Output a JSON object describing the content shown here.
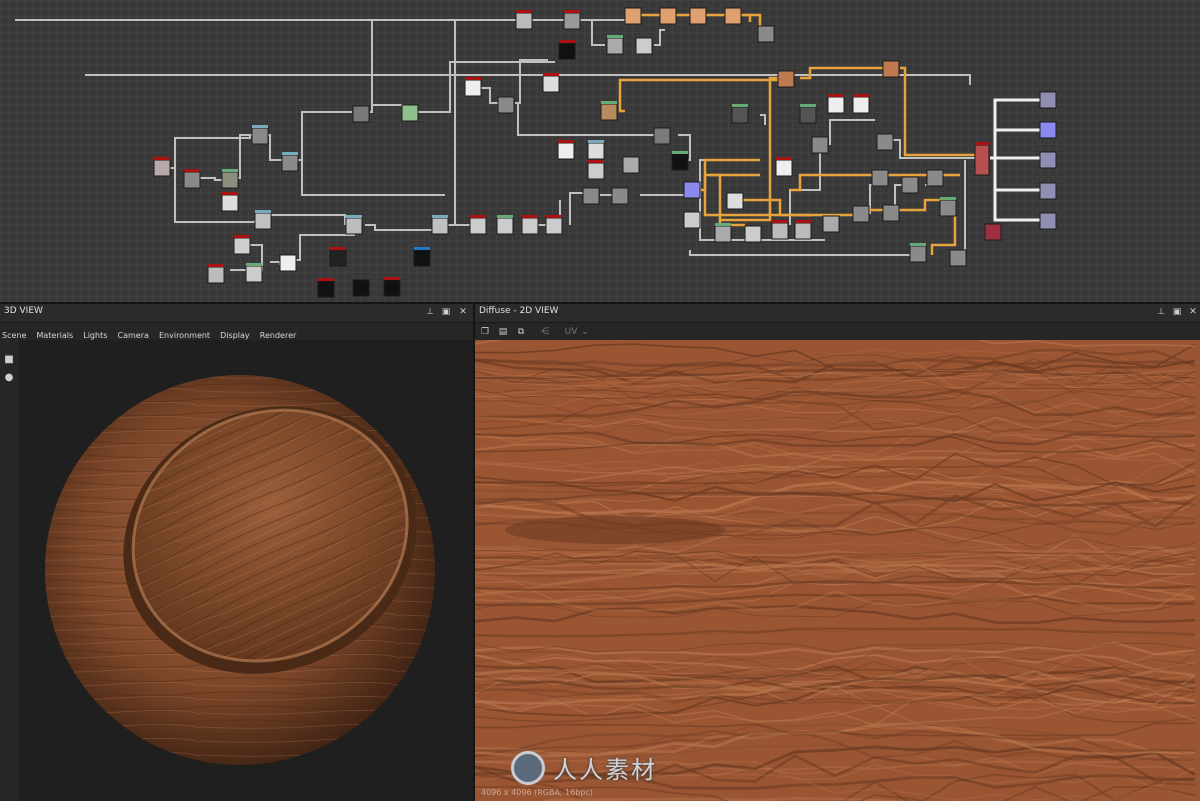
{
  "graph": {
    "colors": {
      "orange": "#e8a33c",
      "gray": "#c0c0c0",
      "white": "#f0f0f0",
      "node": "#7a7a7a"
    }
  },
  "panels": {
    "view3d": {
      "title": "3D VIEW",
      "menu": [
        "Scene",
        "Materials",
        "Lights",
        "Camera",
        "Environment",
        "Display",
        "Renderer"
      ],
      "side_icons": [
        "camera-icon",
        "light-icon"
      ]
    },
    "view2d": {
      "title": "Diffuse - 2D VIEW",
      "toolbar": {
        "uv_label": "UV"
      },
      "status": "4096 x 4096 (RGBA, 16bpc)",
      "watermark": "人人素材"
    },
    "header_icons": {
      "pin": "📌",
      "maximize": "▣",
      "close": "✕"
    }
  },
  "colors": {
    "wood_base": "#9a5633",
    "wood_dark": "#6b3a22",
    "wood_light": "#b9774e",
    "panel_bg": "#2b2b2b"
  }
}
